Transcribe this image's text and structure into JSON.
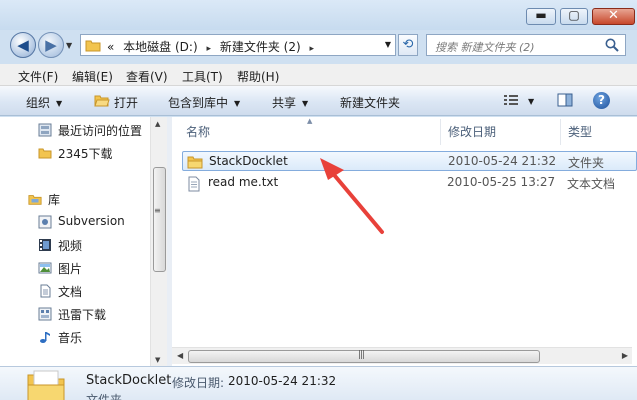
{
  "window": {
    "min_glyph": "▬",
    "max_glyph": "▢",
    "close_glyph": "✕"
  },
  "nav": {
    "back_glyph": "◀",
    "forward_glyph": "▶",
    "breadcrumb_prefix": "«",
    "breadcrumbs": [
      "本地磁盘 (D:)",
      "新建文件夹 (2)"
    ],
    "breadcrumb_separator": "▸",
    "refresh_glyph": "⟲",
    "search_placeholder": "搜索 新建文件夹 (2)"
  },
  "menu": {
    "items": [
      "文件(F)",
      "编辑(E)",
      "查看(V)",
      "工具(T)",
      "帮助(H)"
    ]
  },
  "toolbar": {
    "organize": "组织",
    "open": "打开",
    "include_in_library": "包含到库中",
    "share": "共享",
    "new_folder": "新建文件夹",
    "help_glyph": "?"
  },
  "sidebar": {
    "favorites": [
      {
        "label": "最近访问的位置",
        "icon": "recent-places-icon"
      },
      {
        "label": "2345下载",
        "icon": "folder-icon"
      }
    ],
    "libraries_header": "库",
    "libraries": [
      {
        "label": "Subversion",
        "icon": "subversion-icon"
      },
      {
        "label": "视频",
        "icon": "video-icon"
      },
      {
        "label": "图片",
        "icon": "picture-icon"
      },
      {
        "label": "文档",
        "icon": "document-icon"
      },
      {
        "label": "迅雷下载",
        "icon": "download-icon"
      },
      {
        "label": "音乐",
        "icon": "music-icon"
      }
    ]
  },
  "file_list": {
    "columns": {
      "name": "名称",
      "date": "修改日期",
      "type": "类型"
    },
    "rows": [
      {
        "name": "StackDocklet",
        "date": "2010-05-24 21:32",
        "type": "文件夹",
        "icon": "folder-icon",
        "selected": true
      },
      {
        "name": "read me.txt",
        "date": "2010-05-25 13:27",
        "type": "文本文档",
        "icon": "text-file-icon",
        "selected": false
      }
    ]
  },
  "details": {
    "name": "StackDocklet",
    "date_label": "修改日期:",
    "date_value": "2010-05-24 21:32",
    "type": "文件夹"
  },
  "colors": {
    "annotation_arrow": "#e8413a",
    "selection_border": "#84acdd",
    "folder": "#f2c44f"
  }
}
